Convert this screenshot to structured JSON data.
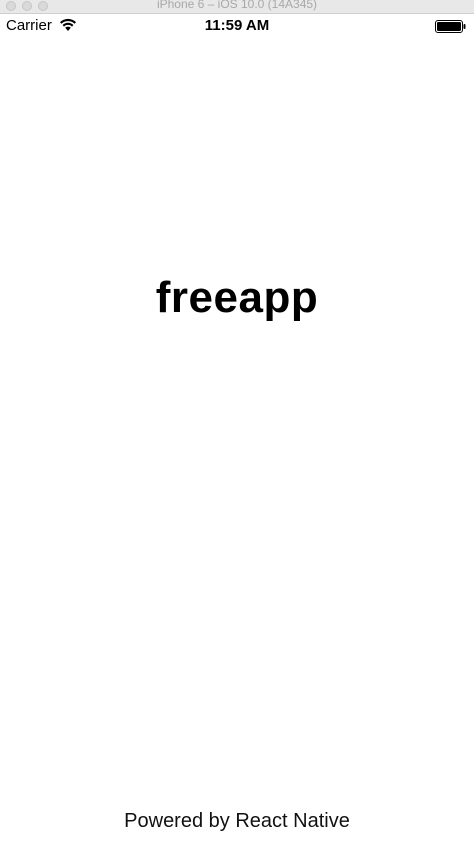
{
  "window": {
    "title": "iPhone 6 – iOS 10.0 (14A345)"
  },
  "statusbar": {
    "carrier": "Carrier",
    "time": "11:59 AM",
    "wifi_icon": "wifi-icon",
    "battery_icon": "battery-icon"
  },
  "main": {
    "app_title": "freeapp",
    "footer": "Powered by React Native"
  },
  "colors": {
    "background": "#ffffff",
    "text": "#000000",
    "titlebar": "#e8e8e8"
  }
}
